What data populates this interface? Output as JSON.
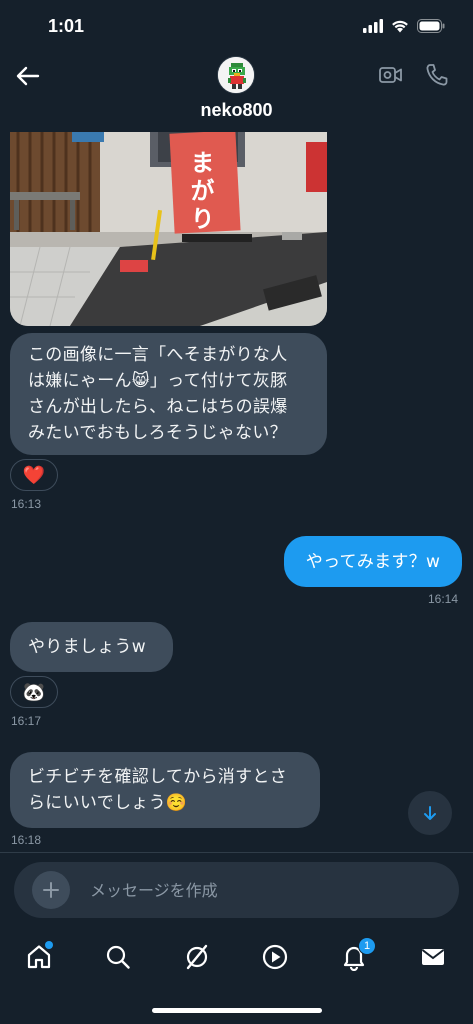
{
  "status_bar": {
    "time": "1:01"
  },
  "header": {
    "name": "neko800",
    "back_icon": "arrow-left-icon",
    "video_icon": "video-camera-icon",
    "call_icon": "phone-icon"
  },
  "messages": {
    "image_sign_text": "まがり",
    "m1": {
      "text": "この画像に一言「へそまがりな人\nは嫌にゃーん😸」って付けて灰豚\nさんが出したら、ねこはちの誤爆\nみたいでおもしろそうじゃない？",
      "reaction": "❤️",
      "time": "16:13"
    },
    "m2": {
      "text": "やってみます？w",
      "time": "16:14"
    },
    "m3": {
      "text": "やりましょうw",
      "reaction": "🐼",
      "time": "16:17"
    },
    "m4": {
      "text": "ビチビチを確認してから消すとさ\nらにいいでしょう☺️",
      "time": "16:18"
    }
  },
  "composer": {
    "placeholder": "メッセージを作成"
  },
  "bottom_nav": {
    "items": [
      "home-icon",
      "search-icon",
      "communities-icon",
      "play-icon",
      "notifications-icon",
      "messages-icon"
    ],
    "notifications_badge": "1"
  },
  "colors": {
    "background": "#15202b",
    "accent": "#1d9bf0",
    "bubble_in": "#3e4c5b"
  }
}
